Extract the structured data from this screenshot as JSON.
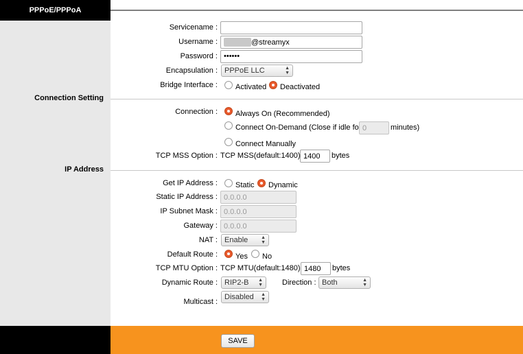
{
  "section_title": "PPPoE/PPPoA",
  "sidebar": {
    "connection_setting": "Connection Setting",
    "ip_address": "IP Address"
  },
  "fields": {
    "servicename": {
      "label": "Servicename :",
      "value": ""
    },
    "username": {
      "label": "Username :",
      "value": "@streamyx"
    },
    "password": {
      "label": "Password :",
      "value": "••••••"
    },
    "encapsulation": {
      "label": "Encapsulation :",
      "value": "PPPoE LLC"
    },
    "bridge_interface": {
      "label": "Bridge Interface :",
      "options": [
        "Activated",
        "Deactivated"
      ],
      "selected": "Deactivated"
    },
    "connection": {
      "label": "Connection :",
      "options": [
        "Always On (Recommended)",
        "Connect On-Demand (Close if idle for",
        "Connect Manually"
      ],
      "selected": "Always On (Recommended)",
      "idle_value": "0",
      "idle_unit": "minutes)"
    },
    "tcp_mss": {
      "label": "TCP MSS Option :",
      "prefix": "TCP MSS(default:1400)",
      "value": "1400",
      "unit": "bytes"
    },
    "get_ip": {
      "label": "Get IP Address :",
      "options": [
        "Static",
        "Dynamic"
      ],
      "selected": "Dynamic"
    },
    "static_ip": {
      "label": "Static IP Address :",
      "value": "0.0.0.0"
    },
    "subnet_mask": {
      "label": "IP Subnet Mask :",
      "value": "0.0.0.0"
    },
    "gateway": {
      "label": "Gateway :",
      "value": "0.0.0.0"
    },
    "nat": {
      "label": "NAT :",
      "value": "Enable"
    },
    "default_route": {
      "label": "Default Route :",
      "options": [
        "Yes",
        "No"
      ],
      "selected": "Yes"
    },
    "tcp_mtu": {
      "label": "TCP MTU Option :",
      "prefix": "TCP MTU(default:1480)",
      "value": "1480",
      "unit": "bytes"
    },
    "dynamic_route": {
      "label": "Dynamic Route :",
      "value": "RIP2-B",
      "direction_label": "Direction :",
      "direction_value": "Both"
    },
    "multicast": {
      "label": "Multicast :",
      "value": "Disabled"
    }
  },
  "footer": {
    "save_label": "SAVE"
  },
  "colors": {
    "accent": "#e9592c",
    "footer": "#f7931e",
    "sidebar": "#e8e8e8"
  }
}
